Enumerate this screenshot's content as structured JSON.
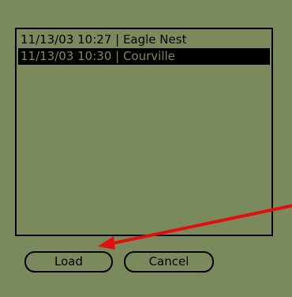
{
  "list": {
    "items": [
      {
        "label": "11/13/03 10:27 | Eagle Nest",
        "selected": false
      },
      {
        "label": "11/13/03 10:30 | Courville",
        "selected": true
      }
    ]
  },
  "buttons": {
    "load_label": "Load",
    "cancel_label": "Cancel"
  },
  "colors": {
    "background": "#7a8a5c",
    "text": "#000000",
    "annotation_arrow": "#e01010"
  }
}
